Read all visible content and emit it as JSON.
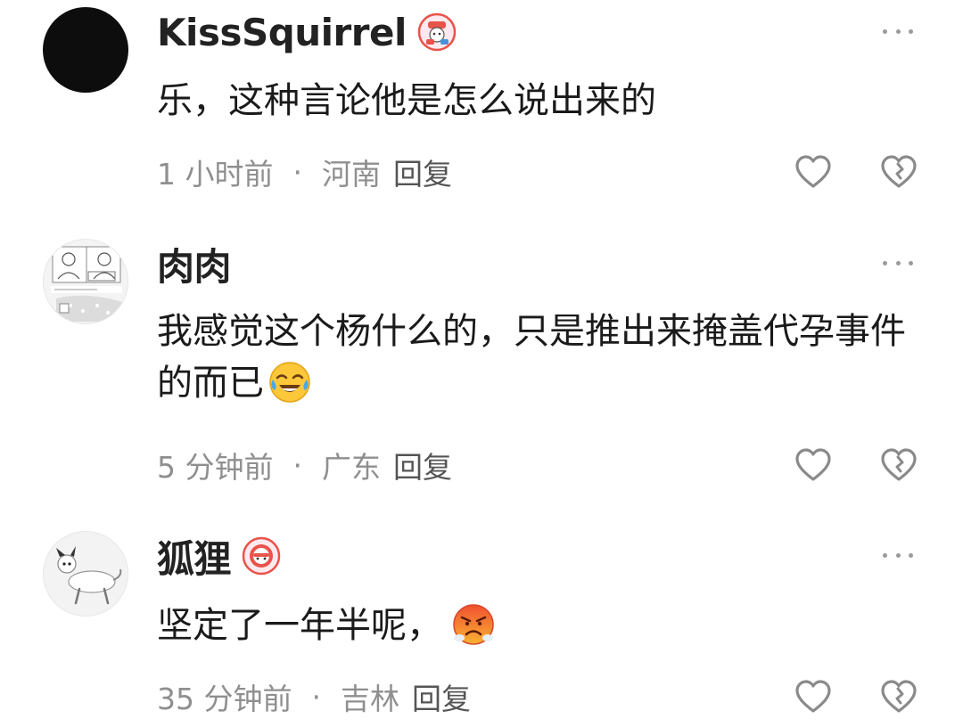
{
  "comments": [
    {
      "username": "KissSquirrel",
      "text": "乐，这种言论他是怎么说出来的",
      "time": "1 小时前",
      "separator": "·",
      "location": "河南",
      "reply_label": "回复"
    },
    {
      "username": "肉肉",
      "text": "我感觉这个杨什么的，只是推出来掩盖代孕事件的而已",
      "time": "5 分钟前",
      "separator": "·",
      "location": "广东",
      "reply_label": "回复"
    },
    {
      "username": "狐狸",
      "text": "坚定了一年半呢，",
      "time": "35 分钟前",
      "separator": "·",
      "location": "吉林",
      "reply_label": "回复"
    }
  ],
  "icons": {
    "more": "more-dots-icon",
    "like": "heart-icon",
    "dislike": "broken-heart-icon",
    "emoji_laugh": "crying-laughing-emoji",
    "emoji_angry": "angry-steam-emoji"
  },
  "colors": {
    "username": "#222222",
    "meta_text": "#8f8f8f",
    "icon_stroke": "#8a8a8a",
    "badge_red": "#e8534a"
  }
}
